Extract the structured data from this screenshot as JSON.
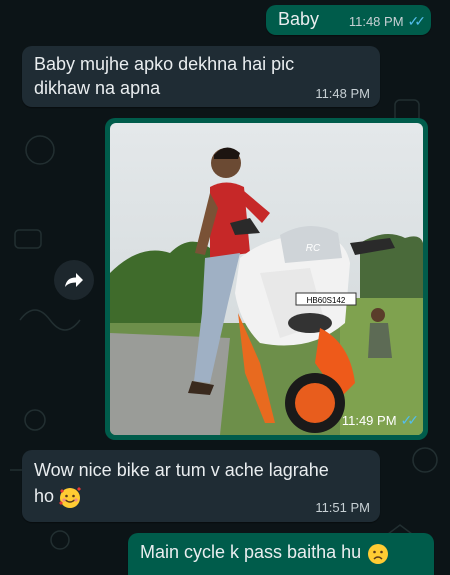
{
  "messages": [
    {
      "direction": "outgoing",
      "text": "Baby",
      "time": "11:48 PM",
      "ticks": "✓✓"
    },
    {
      "direction": "incoming",
      "text_line1": "Baby mujhe apko dekhna hai pic",
      "text_line2": "dikhaw na apna",
      "time": "11:48 PM"
    },
    {
      "direction": "outgoing",
      "type": "image",
      "time": "11:49 PM",
      "ticks": "✓✓",
      "plate": "HB60S142",
      "fairing_text": "RC"
    },
    {
      "direction": "incoming",
      "text_line1": "Wow nice bike ar tum v ache lagrahe",
      "text_line2": "ho",
      "emoji": "smiling-face-with-hearts",
      "time": "11:51 PM"
    },
    {
      "direction": "outgoing",
      "text": "Main cycle k pass baitha hu",
      "emoji": "frowning-face"
    }
  ],
  "icons": {
    "forward": "forward-arrow-icon"
  },
  "colors": {
    "outgoing": "#005c4b",
    "incoming": "#1f2c34",
    "background": "#0c1417",
    "read_ticks": "#53bdeb"
  }
}
